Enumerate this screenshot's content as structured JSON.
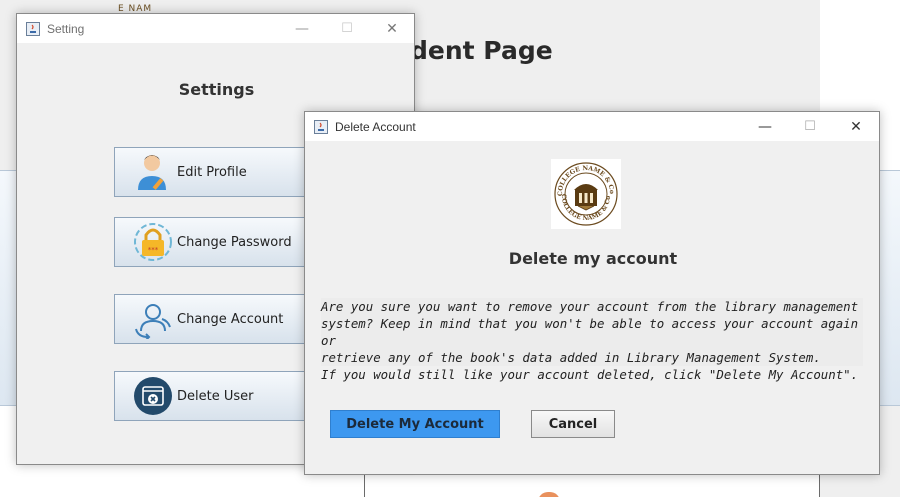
{
  "background": {
    "page_title": "dent Page",
    "logo_peek_text": "E NAM"
  },
  "settings_window": {
    "title": "Setting",
    "heading": "Settings",
    "buttons": [
      {
        "label": "Edit Profile",
        "icon": "user-edit-icon"
      },
      {
        "label": "Change Password",
        "icon": "lock-icon"
      },
      {
        "label": "Change Account",
        "icon": "account-switch-icon"
      },
      {
        "label": "Delete User",
        "icon": "delete-user-icon"
      }
    ]
  },
  "delete_dialog": {
    "title": "Delete Account",
    "logo_text_top": "COLLEGE NAME & Co.",
    "logo_text_bottom": "COLLEGE NAME & Co.",
    "heading": "Delete my account",
    "message_lines": [
      "Are you sure you want to remove your account from the library management",
      "system? Keep in mind that you won't be able to access your account again or",
      "retrieve any of the book's data added in Library Management System."
    ],
    "note": "If you would still like your account deleted, click \"Delete My Account\".",
    "primary_button": "Delete My Account",
    "cancel_button": "Cancel"
  },
  "window_controls": {
    "minimize": "—",
    "maximize": "☐",
    "close": "✕"
  },
  "colors": {
    "primary_button": "#3d98f0",
    "logo_brown": "#6b4a1e"
  }
}
